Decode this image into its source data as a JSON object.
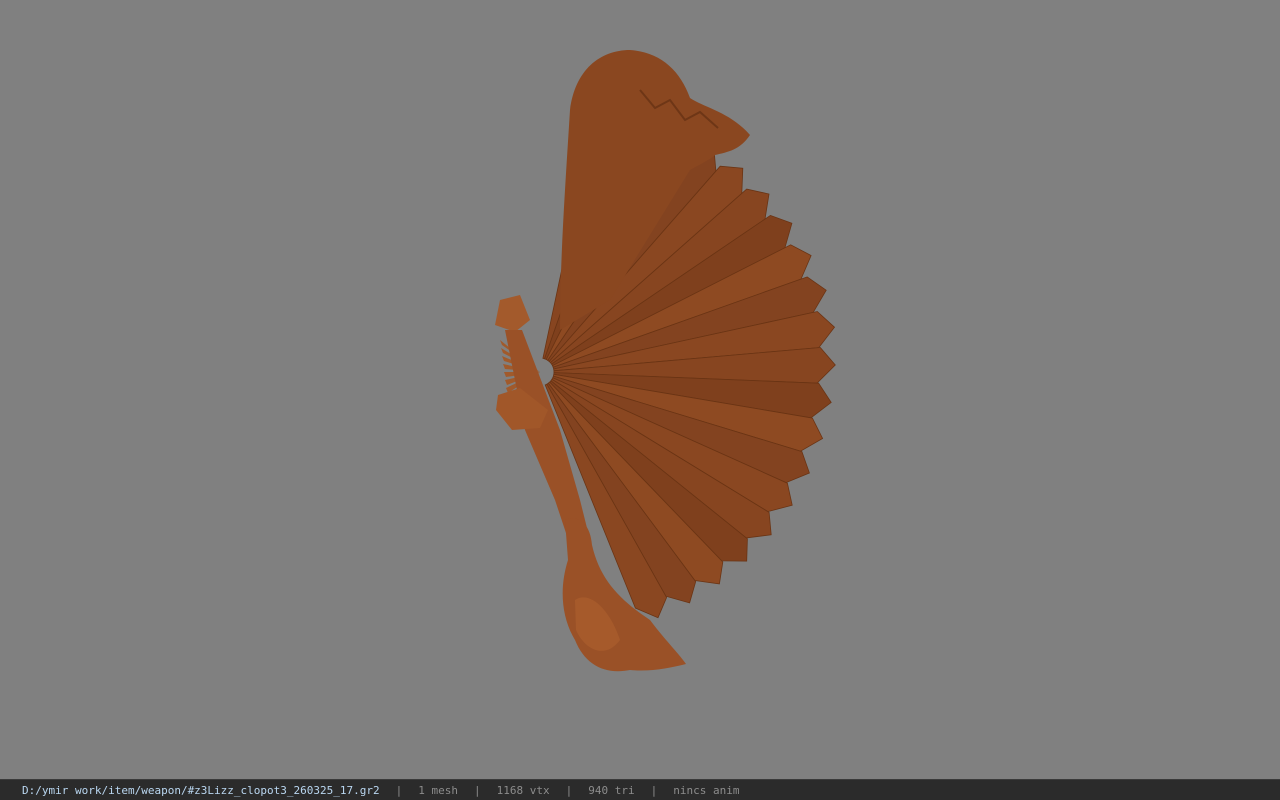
{
  "viewport": {
    "background_color": "#808080",
    "model_color": "#8b4a22",
    "model_description_icon": "folding-fan-model"
  },
  "statusbar": {
    "file_path": "D:/ymir work/item/weapon/#z3Lizz_clopot3_260325_17.gr2",
    "separator": "|",
    "mesh_count": "1 mesh",
    "vertex_count": "1168 vtx",
    "triangle_count": "940 tri",
    "anim_status": "nincs anim"
  }
}
